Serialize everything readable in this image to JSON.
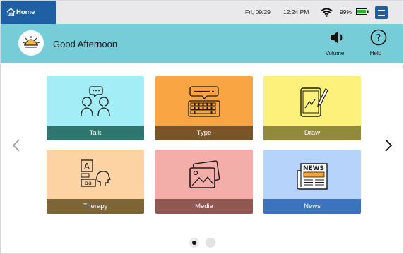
{
  "statusbar": {
    "home_label": "Home",
    "date": "Fri, 09/29",
    "time": "12:24 PM",
    "battery": "99%"
  },
  "header": {
    "greeting": "Good Afternoon",
    "volume_label": "Volume",
    "help_label": "Help"
  },
  "tiles": [
    {
      "label": "Talk",
      "icon": "two-people-talking-icon",
      "bg": "#a3eef6",
      "band": "#2e766e"
    },
    {
      "label": "Type",
      "icon": "keyboard-message-icon",
      "bg": "#f9a543",
      "band": "#7a5529"
    },
    {
      "label": "Draw",
      "icon": "tablet-pen-icon",
      "bg": "#fdf07b",
      "band": "#928a3b"
    },
    {
      "label": "Therapy",
      "icon": "therapy-letters-icon",
      "bg": "#fdd3a3",
      "band": "#7d6536"
    },
    {
      "label": "Media",
      "icon": "photos-icon",
      "bg": "#f4aea9",
      "band": "#905853"
    },
    {
      "label": "News",
      "icon": "newspaper-icon",
      "bg": "#b6d4fb",
      "band": "#3c73bd"
    }
  ],
  "pagination": {
    "current_page": 1,
    "total_pages": 2
  },
  "colors": {
    "header": "#76cdd8",
    "accent": "#1f5fa3",
    "statusbar": "#e9e9ec"
  }
}
